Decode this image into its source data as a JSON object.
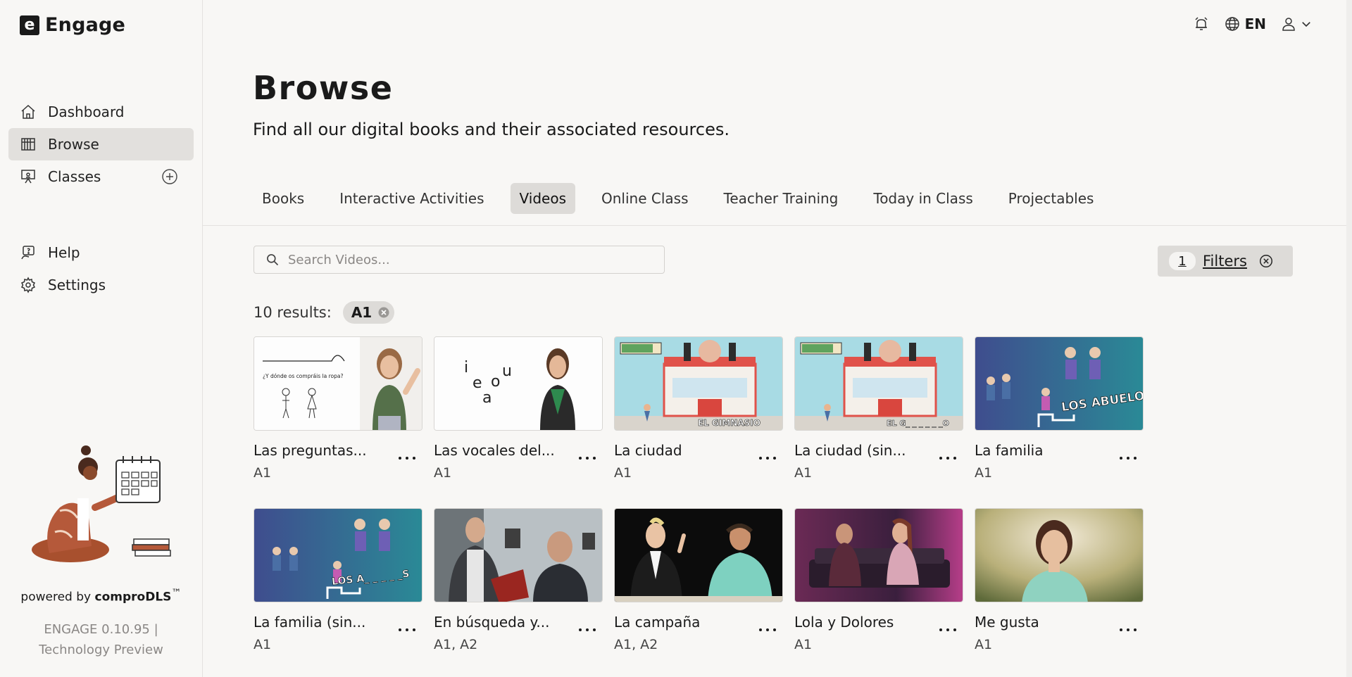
{
  "app": {
    "logo_letter": "e",
    "name": "Engage"
  },
  "sidebar": {
    "primary": [
      {
        "label": "Dashboard",
        "icon": "home-icon"
      },
      {
        "label": "Browse",
        "icon": "library-icon",
        "active": true
      },
      {
        "label": "Classes",
        "icon": "classroom-icon",
        "has_add": true
      }
    ],
    "secondary": [
      {
        "label": "Help",
        "icon": "help-icon"
      },
      {
        "label": "Settings",
        "icon": "gear-icon"
      }
    ],
    "powered_prefix": "powered by ",
    "powered_brand": "comproDLS",
    "powered_tm": "™",
    "version_line1": "ENGAGE 0.10.95 |",
    "version_line2": "Technology Preview"
  },
  "topbar": {
    "language": "EN"
  },
  "page": {
    "title": "Browse",
    "subtitle": "Find all our digital books and their associated resources."
  },
  "tabs": [
    {
      "label": "Books"
    },
    {
      "label": "Interactive Activities"
    },
    {
      "label": "Videos",
      "active": true
    },
    {
      "label": "Online Class"
    },
    {
      "label": "Teacher Training"
    },
    {
      "label": "Today in Class"
    },
    {
      "label": "Projectables"
    }
  ],
  "search": {
    "placeholder": "Search Videos...",
    "value": ""
  },
  "filters": {
    "count": "1",
    "label": "Filters"
  },
  "results": {
    "text": "10 results:",
    "chip": "A1"
  },
  "cards": [
    {
      "title": "Las preguntas...",
      "level": "A1",
      "thumb": "whiteboard-teacher",
      "thumb_text": "¿Y dónde os compráis la ropa?"
    },
    {
      "title": "Las vocales del...",
      "level": "A1",
      "thumb": "vowels-teacher",
      "thumb_letters": [
        "i",
        "u",
        "e",
        "o",
        "a"
      ]
    },
    {
      "title": "La ciudad",
      "level": "A1",
      "thumb": "gym-cartoon",
      "thumb_text": "EL GIMNASIO"
    },
    {
      "title": "La ciudad (sin...",
      "level": "A1",
      "thumb": "gym-cartoon",
      "thumb_text": "EL G_ _ _ _ _ _O"
    },
    {
      "title": "La familia",
      "level": "A1",
      "thumb": "family-cartoon",
      "thumb_text": "LOS ABUELOS"
    },
    {
      "title": "La familia (sin...",
      "level": "A1",
      "thumb": "family-cartoon",
      "thumb_text": "LOS A_ _ _ _ _S"
    },
    {
      "title": "En búsqueda y...",
      "level": "A1, A2",
      "thumb": "office-scene"
    },
    {
      "title": "La campaña",
      "level": "A1, A2",
      "thumb": "debate-scene"
    },
    {
      "title": "Lola y Dolores",
      "level": "A1",
      "thumb": "sofa-scene"
    },
    {
      "title": "Me gusta",
      "level": "A1",
      "thumb": "park-portrait"
    }
  ]
}
